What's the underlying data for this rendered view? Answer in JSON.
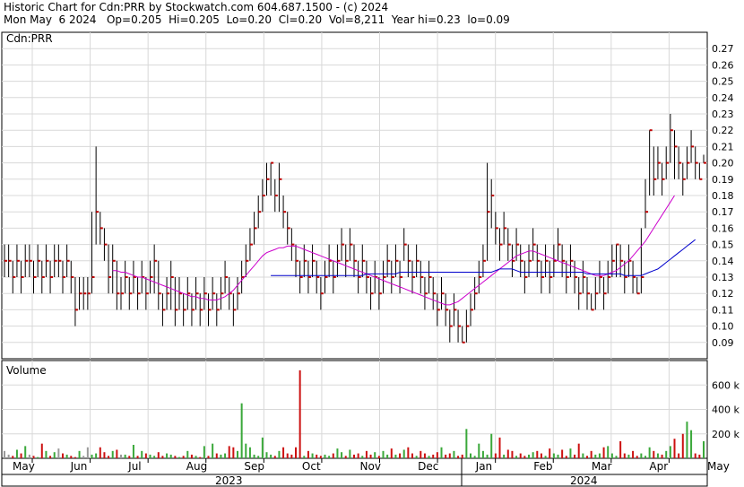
{
  "header": {
    "line1": "Historic Chart for Cdn:PRR by Stockwatch.com 604.687.1500 - (c) 2024",
    "line2": "Mon May  6 2024   Op=0.205  Hi=0.205  Lo=0.20  Cl=0.20  Vol=8,211  Year hi=0.23  lo=0.09"
  },
  "colors": {
    "up": "#008000",
    "down": "#c00000",
    "ma_short": "#cc00cc",
    "ma_long": "#0000cc",
    "volume_up": "#3aa83a",
    "volume_down": "#cc1111",
    "volume_neutral": "#999999"
  },
  "chart_data": {
    "type": "ohlc",
    "title": "Cdn:PRR",
    "price_panel_label": "Cdn:PRR",
    "volume_panel_label": "Volume",
    "ylim": [
      0.08,
      0.28
    ],
    "yticks": [
      "0.09",
      "0.10",
      "0.11",
      "0.12",
      "0.13",
      "0.14",
      "0.15",
      "0.16",
      "0.17",
      "0.18",
      "0.19",
      "0.20",
      "0.21",
      "0.22",
      "0.23",
      "0.24",
      "0.25",
      "0.26",
      "0.27"
    ],
    "volume_ticks": [
      "200 k",
      "400 k",
      "600 k"
    ],
    "volume_ylim": [
      0,
      800
    ],
    "months": [
      "May",
      "Jun",
      "Jul",
      "Aug",
      "Sep",
      "Oct",
      "Nov",
      "Dec",
      "Jan",
      "Feb",
      "Mar",
      "Apr",
      "May"
    ],
    "years": [
      "2023",
      "2024"
    ],
    "price_close": [
      0.14,
      0.14,
      0.13,
      0.14,
      0.13,
      0.14,
      0.14,
      0.13,
      0.14,
      0.13,
      0.14,
      0.13,
      0.14,
      0.14,
      0.13,
      0.14,
      0.13,
      0.11,
      0.12,
      0.12,
      0.12,
      0.13,
      0.17,
      0.16,
      0.15,
      0.13,
      0.14,
      0.12,
      0.12,
      0.13,
      0.12,
      0.13,
      0.12,
      0.13,
      0.12,
      0.13,
      0.14,
      0.12,
      0.11,
      0.12,
      0.13,
      0.11,
      0.12,
      0.11,
      0.12,
      0.11,
      0.12,
      0.11,
      0.12,
      0.11,
      0.12,
      0.11,
      0.12,
      0.13,
      0.12,
      0.11,
      0.12,
      0.13,
      0.14,
      0.15,
      0.16,
      0.17,
      0.18,
      0.19,
      0.2,
      0.18,
      0.19,
      0.17,
      0.16,
      0.15,
      0.14,
      0.13,
      0.14,
      0.13,
      0.14,
      0.13,
      0.12,
      0.13,
      0.14,
      0.13,
      0.14,
      0.15,
      0.14,
      0.15,
      0.14,
      0.13,
      0.14,
      0.13,
      0.12,
      0.13,
      0.12,
      0.13,
      0.14,
      0.13,
      0.14,
      0.13,
      0.15,
      0.14,
      0.13,
      0.14,
      0.13,
      0.12,
      0.13,
      0.12,
      0.11,
      0.12,
      0.11,
      0.1,
      0.11,
      0.1,
      0.09,
      0.1,
      0.11,
      0.12,
      0.13,
      0.14,
      0.17,
      0.18,
      0.16,
      0.15,
      0.16,
      0.15,
      0.14,
      0.15,
      0.14,
      0.13,
      0.14,
      0.15,
      0.14,
      0.13,
      0.14,
      0.13,
      0.14,
      0.15,
      0.14,
      0.13,
      0.14,
      0.13,
      0.12,
      0.13,
      0.12,
      0.11,
      0.12,
      0.13,
      0.12,
      0.13,
      0.14,
      0.15,
      0.14,
      0.13,
      0.14,
      0.13,
      0.12,
      0.13,
      0.17,
      0.22,
      0.19,
      0.2,
      0.19,
      0.2,
      0.22,
      0.21,
      0.2,
      0.19,
      0.2,
      0.21,
      0.2,
      0.19,
      0.2
    ],
    "price_high": [
      0.15,
      0.15,
      0.14,
      0.15,
      0.14,
      0.15,
      0.15,
      0.14,
      0.15,
      0.14,
      0.15,
      0.14,
      0.15,
      0.15,
      0.14,
      0.15,
      0.14,
      0.13,
      0.13,
      0.13,
      0.13,
      0.17,
      0.21,
      0.17,
      0.16,
      0.15,
      0.15,
      0.14,
      0.13,
      0.14,
      0.13,
      0.14,
      0.13,
      0.14,
      0.13,
      0.14,
      0.15,
      0.14,
      0.12,
      0.13,
      0.14,
      0.13,
      0.13,
      0.12,
      0.13,
      0.12,
      0.13,
      0.12,
      0.13,
      0.12,
      0.13,
      0.12,
      0.13,
      0.14,
      0.13,
      0.12,
      0.13,
      0.14,
      0.15,
      0.16,
      0.17,
      0.18,
      0.19,
      0.2,
      0.2,
      0.19,
      0.2,
      0.18,
      0.17,
      0.16,
      0.15,
      0.14,
      0.15,
      0.14,
      0.15,
      0.14,
      0.13,
      0.14,
      0.15,
      0.14,
      0.15,
      0.16,
      0.15,
      0.16,
      0.15,
      0.14,
      0.15,
      0.14,
      0.13,
      0.14,
      0.13,
      0.14,
      0.15,
      0.14,
      0.15,
      0.14,
      0.16,
      0.15,
      0.14,
      0.15,
      0.14,
      0.13,
      0.14,
      0.13,
      0.12,
      0.13,
      0.12,
      0.11,
      0.12,
      0.11,
      0.1,
      0.11,
      0.12,
      0.13,
      0.14,
      0.15,
      0.2,
      0.19,
      0.17,
      0.16,
      0.17,
      0.16,
      0.15,
      0.16,
      0.15,
      0.14,
      0.15,
      0.16,
      0.15,
      0.14,
      0.15,
      0.14,
      0.15,
      0.16,
      0.15,
      0.14,
      0.15,
      0.14,
      0.13,
      0.14,
      0.13,
      0.12,
      0.13,
      0.14,
      0.13,
      0.14,
      0.15,
      0.15,
      0.15,
      0.14,
      0.15,
      0.14,
      0.13,
      0.16,
      0.19,
      0.22,
      0.21,
      0.21,
      0.2,
      0.21,
      0.23,
      0.22,
      0.21,
      0.2,
      0.21,
      0.22,
      0.21,
      0.2,
      0.205
    ],
    "price_low": [
      0.13,
      0.13,
      0.12,
      0.13,
      0.12,
      0.13,
      0.13,
      0.12,
      0.13,
      0.12,
      0.13,
      0.12,
      0.13,
      0.13,
      0.12,
      0.13,
      0.12,
      0.1,
      0.11,
      0.11,
      0.11,
      0.12,
      0.15,
      0.15,
      0.14,
      0.12,
      0.12,
      0.11,
      0.11,
      0.12,
      0.11,
      0.12,
      0.11,
      0.12,
      0.11,
      0.12,
      0.12,
      0.11,
      0.1,
      0.11,
      0.11,
      0.1,
      0.11,
      0.1,
      0.11,
      0.1,
      0.11,
      0.1,
      0.11,
      0.1,
      0.11,
      0.1,
      0.11,
      0.12,
      0.11,
      0.1,
      0.11,
      0.12,
      0.13,
      0.14,
      0.15,
      0.16,
      0.17,
      0.18,
      0.18,
      0.17,
      0.17,
      0.16,
      0.15,
      0.14,
      0.13,
      0.12,
      0.13,
      0.12,
      0.13,
      0.12,
      0.11,
      0.12,
      0.13,
      0.12,
      0.13,
      0.14,
      0.13,
      0.14,
      0.13,
      0.12,
      0.13,
      0.12,
      0.11,
      0.12,
      0.11,
      0.12,
      0.13,
      0.12,
      0.13,
      0.12,
      0.14,
      0.13,
      0.12,
      0.13,
      0.12,
      0.11,
      0.12,
      0.11,
      0.1,
      0.11,
      0.1,
      0.09,
      0.1,
      0.09,
      0.09,
      0.09,
      0.1,
      0.11,
      0.12,
      0.13,
      0.14,
      0.16,
      0.15,
      0.14,
      0.15,
      0.14,
      0.13,
      0.14,
      0.13,
      0.12,
      0.13,
      0.14,
      0.13,
      0.12,
      0.13,
      0.12,
      0.13,
      0.14,
      0.13,
      0.12,
      0.13,
      0.12,
      0.11,
      0.12,
      0.11,
      0.11,
      0.11,
      0.12,
      0.11,
      0.12,
      0.13,
      0.13,
      0.13,
      0.12,
      0.13,
      0.12,
      0.12,
      0.12,
      0.16,
      0.18,
      0.18,
      0.19,
      0.18,
      0.19,
      0.2,
      0.19,
      0.19,
      0.18,
      0.19,
      0.2,
      0.19,
      0.19,
      0.2
    ],
    "ma_short": [
      null,
      null,
      null,
      null,
      null,
      null,
      null,
      null,
      null,
      null,
      null,
      null,
      null,
      null,
      null,
      null,
      null,
      null,
      null,
      null,
      null,
      null,
      null,
      null,
      null,
      null,
      0.134,
      0.134,
      0.133,
      0.133,
      0.132,
      0.131,
      0.13,
      0.13,
      0.129,
      0.128,
      0.127,
      0.126,
      0.125,
      0.124,
      0.123,
      0.122,
      0.121,
      0.12,
      0.119,
      0.118,
      0.118,
      0.117,
      0.117,
      0.116,
      0.116,
      0.116,
      0.117,
      0.118,
      0.12,
      0.122,
      0.125,
      0.128,
      0.131,
      0.134,
      0.137,
      0.14,
      0.143,
      0.145,
      0.146,
      0.147,
      0.148,
      0.148,
      0.149,
      0.149,
      0.149,
      0.148,
      0.147,
      0.146,
      0.145,
      0.144,
      0.143,
      0.142,
      0.141,
      0.14,
      0.139,
      0.138,
      0.137,
      0.136,
      0.135,
      0.134,
      0.133,
      0.132,
      0.131,
      0.13,
      0.129,
      0.128,
      0.127,
      0.126,
      0.125,
      0.124,
      0.123,
      0.122,
      0.121,
      0.12,
      0.119,
      0.118,
      0.117,
      0.116,
      0.115,
      0.114,
      0.113,
      0.113,
      0.114,
      0.115,
      0.117,
      0.119,
      0.121,
      0.123,
      0.125,
      0.127,
      0.129,
      0.131,
      0.133,
      0.135,
      0.137,
      0.139,
      0.141,
      0.143,
      0.144,
      0.145,
      0.146,
      0.146,
      0.145,
      0.144,
      0.143,
      0.142,
      0.141,
      0.14,
      0.139,
      0.138,
      0.137,
      0.136,
      0.135,
      0.134,
      0.133,
      0.132,
      0.131,
      0.131,
      0.131,
      0.132,
      0.133,
      0.134,
      0.136,
      0.138,
      0.14,
      0.143,
      0.146,
      0.149,
      0.152,
      0.156,
      0.16,
      0.164,
      0.168,
      0.172,
      0.176,
      0.18
    ],
    "ma_long": [
      null,
      null,
      null,
      null,
      null,
      null,
      null,
      null,
      null,
      null,
      null,
      null,
      null,
      null,
      null,
      null,
      null,
      null,
      null,
      null,
      null,
      null,
      null,
      null,
      null,
      null,
      null,
      null,
      null,
      null,
      null,
      null,
      null,
      null,
      null,
      null,
      null,
      null,
      null,
      null,
      null,
      null,
      null,
      null,
      null,
      null,
      null,
      null,
      null,
      null,
      null,
      null,
      null,
      null,
      null,
      null,
      null,
      null,
      null,
      null,
      null,
      null,
      null,
      null,
      0.131,
      0.131,
      0.131,
      0.131,
      0.131,
      0.131,
      0.131,
      0.131,
      0.131,
      0.131,
      0.131,
      0.131,
      0.131,
      0.131,
      0.131,
      0.131,
      0.131,
      0.131,
      0.131,
      0.131,
      0.131,
      0.131,
      0.131,
      0.132,
      0.132,
      0.132,
      0.132,
      0.132,
      0.132,
      0.132,
      0.132,
      0.133,
      0.133,
      0.133,
      0.133,
      0.133,
      0.133,
      0.133,
      0.133,
      0.133,
      0.133,
      0.133,
      0.133,
      0.133,
      0.133,
      0.133,
      0.133,
      0.133,
      0.133,
      0.133,
      0.133,
      0.133,
      0.133,
      0.133,
      0.134,
      0.135,
      0.135,
      0.135,
      0.135,
      0.134,
      0.133,
      0.133,
      0.133,
      0.133,
      0.133,
      0.133,
      0.133,
      0.133,
      0.133,
      0.133,
      0.133,
      0.133,
      0.133,
      0.133,
      0.133,
      0.133,
      0.132,
      0.132,
      0.132,
      0.132,
      0.132,
      0.132,
      0.132,
      0.132,
      0.132,
      0.131,
      0.131,
      0.131,
      0.131,
      0.131,
      0.132,
      0.133,
      0.134,
      0.135,
      0.137,
      0.139,
      0.141,
      0.143,
      0.145,
      0.147,
      0.149,
      0.151,
      0.153
    ],
    "volume": [
      60,
      30,
      20,
      70,
      40,
      100,
      30,
      20,
      10,
      120,
      60,
      20,
      50,
      80,
      40,
      30,
      20,
      10,
      60,
      20,
      90,
      30,
      40,
      90,
      50,
      20,
      60,
      70,
      30,
      30,
      20,
      110,
      20,
      60,
      40,
      30,
      20,
      50,
      20,
      40,
      30,
      20,
      10,
      20,
      60,
      30,
      20,
      10,
      100,
      20,
      120,
      40,
      30,
      40,
      100,
      90,
      60,
      450,
      120,
      90,
      30,
      20,
      170,
      50,
      30,
      20,
      60,
      90,
      40,
      30,
      90,
      720,
      20,
      60,
      40,
      30,
      20,
      30,
      20,
      40,
      80,
      50,
      20,
      70,
      30,
      40,
      20,
      60,
      30,
      50,
      20,
      60,
      30,
      80,
      30,
      40,
      70,
      90,
      40,
      20,
      60,
      40,
      20,
      30,
      50,
      90,
      30,
      40,
      60,
      20,
      30,
      240,
      40,
      20,
      120,
      60,
      30,
      200,
      40,
      170,
      30,
      70,
      60,
      20,
      40,
      20,
      30,
      50,
      60,
      40,
      20,
      80,
      40,
      30,
      70,
      20,
      80,
      30,
      120,
      40,
      20,
      60,
      30,
      40,
      90,
      100,
      40,
      20,
      140,
      40,
      30,
      60,
      20,
      40,
      20,
      90,
      60,
      40,
      30,
      60,
      100,
      160,
      40,
      200,
      300,
      230,
      40,
      30,
      140,
      50,
      20,
      20,
      40,
      70,
      60,
      30
    ]
  }
}
